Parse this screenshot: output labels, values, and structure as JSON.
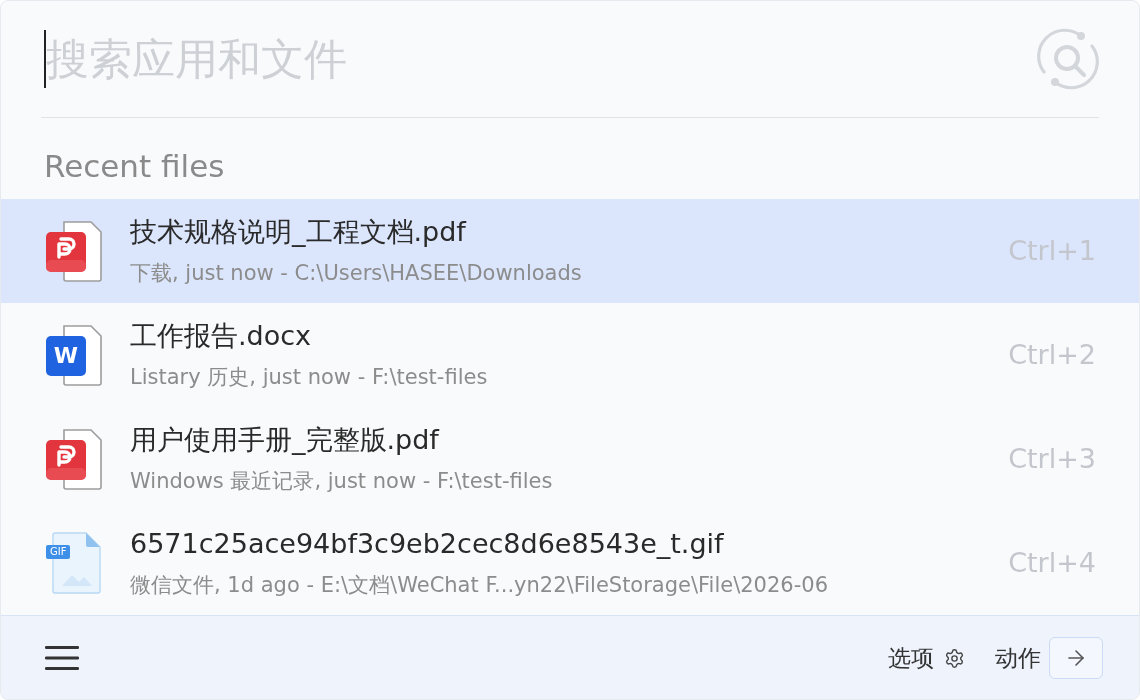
{
  "search": {
    "placeholder": "搜索应用和文件"
  },
  "section_title": "Recent files",
  "files": [
    {
      "kind": "pdf",
      "name": "技术规格说明_工程文档.pdf",
      "detail": "下载, just now - C:\\Users\\HASEE\\Downloads",
      "shortcut": "Ctrl+1",
      "selected": true
    },
    {
      "kind": "word",
      "badge": "W",
      "name": "工作报告.docx",
      "detail": "Listary 历史, just now - F:\\test-files",
      "shortcut": "Ctrl+2",
      "selected": false
    },
    {
      "kind": "pdf",
      "name": "用户使用手册_完整版.pdf",
      "detail": "Windows 最近记录, just now - F:\\test-files",
      "shortcut": "Ctrl+3",
      "selected": false
    },
    {
      "kind": "gif",
      "badge": "GIF",
      "name": "6571c25ace94bf3c9eb2cec8d6e8543e_t.gif",
      "detail": "微信文件, 1d ago - E:\\文档\\WeChat F...yn22\\FileStorage\\File\\2026-06",
      "shortcut": "Ctrl+4",
      "selected": false
    }
  ],
  "footer": {
    "options_label": "选项",
    "action_label": "动作"
  }
}
